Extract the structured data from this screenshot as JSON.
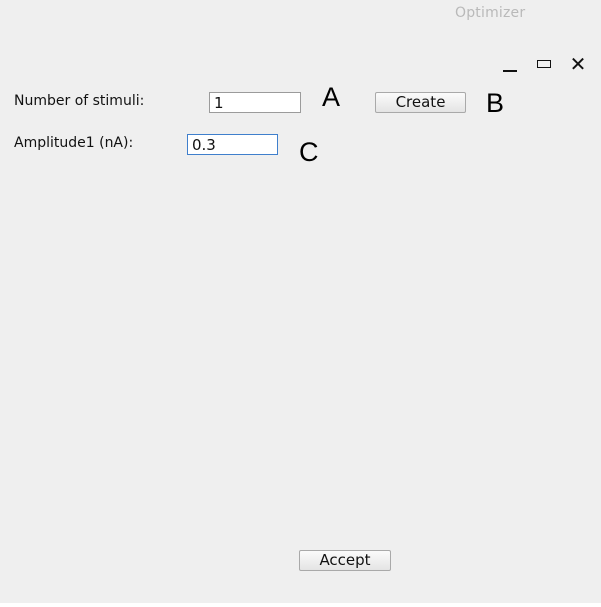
{
  "window": {
    "title": "Optimizer",
    "controls": {
      "minimize": "minimize-icon",
      "maximize": "maximize-icon",
      "close": "close-icon",
      "close_glyph": "✕"
    }
  },
  "form": {
    "stimuli_label": "Number of stimuli:",
    "stimuli_value": "1",
    "create_label": "Create",
    "amplitude_label": "Amplitude1 (nA):",
    "amplitude_value": "0.3",
    "accept_label": "Accept"
  },
  "annotations": {
    "a": "A",
    "b": "B",
    "c": "C"
  }
}
